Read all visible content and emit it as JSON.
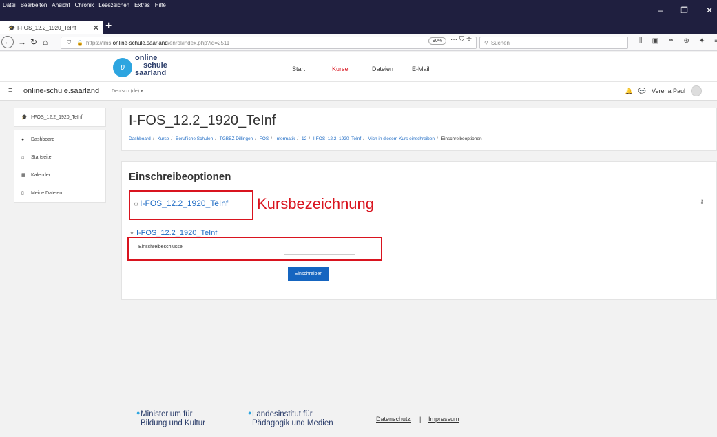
{
  "browser": {
    "menu": [
      "Datei",
      "Bearbeiten",
      "Ansicht",
      "Chronik",
      "Lesezeichen",
      "Extras",
      "Hilfe"
    ],
    "tab_title": "I-FOS_12.2_1920_TeInf",
    "url_prefix": "https://lms.",
    "url_domain": "online-schule.saarland",
    "url_path": "/enrol/index.php?id=2511",
    "zoom": "90%",
    "search_placeholder": "Suchen"
  },
  "header": {
    "logo_line1": "online",
    "logo_line2": "schule",
    "logo_line3": "saarland",
    "nav": [
      "Start",
      "Kurse",
      "Dateien",
      "E-Mail"
    ]
  },
  "subbar": {
    "site_name": "online-schule.saarland",
    "language": "Deutsch (de) ▾",
    "user": "Verena Paul"
  },
  "sidebar": {
    "course": "I-FOS_12.2_1920_TeInf",
    "items": [
      "Dashboard",
      "Startseite",
      "Kalender",
      "Meine Dateien"
    ]
  },
  "main": {
    "title": "I-FOS_12.2_1920_TeInf",
    "breadcrumb": [
      "Dashboard",
      "Kurse",
      "Berufliche Schulen",
      "TGBBZ Dillingen",
      "FOS",
      "Informatik",
      "12",
      "I-FOS_12.2_1920_TeInf",
      "Mich in diesem Kurs einschreiben",
      "Einschreibeoptionen"
    ],
    "section_title": "Einschreibeoptionen",
    "course_link": "I-FOS_12.2_1920_TeInf",
    "fieldset_title": "I-FOS_12.2_1920_TeInf",
    "key_label": "Einschreibeschlüssel",
    "key_value": "",
    "enrol_button": "Einschreiben"
  },
  "annotation": {
    "label": "Kursbezeichnung",
    "color": "#d9141f"
  },
  "footer": {
    "org1_line1": "Ministerium für",
    "org1_line2": "Bildung und Kultur",
    "org2_line1": "Landesinstitut für",
    "org2_line2": "Pädagogik und Medien",
    "privacy": "Datenschutz",
    "separator": "|",
    "imprint": "Impressum"
  }
}
